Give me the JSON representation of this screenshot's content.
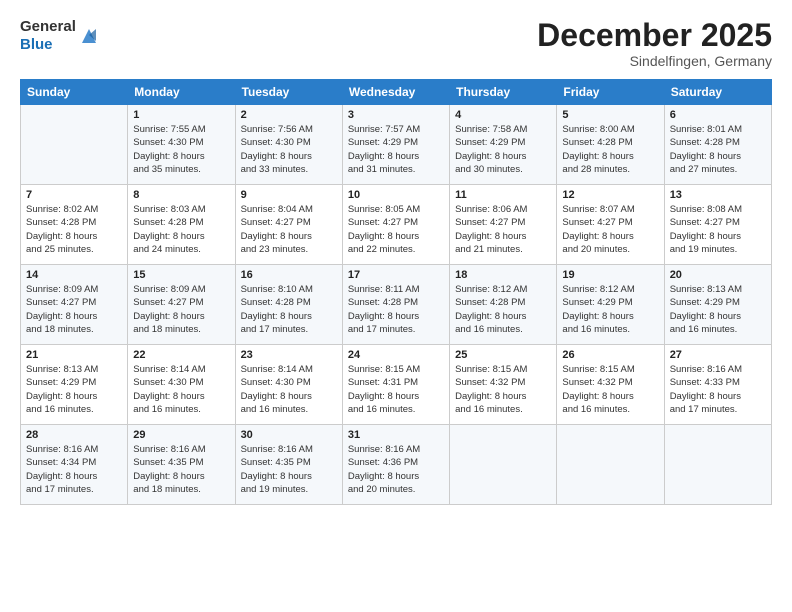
{
  "logo": {
    "line1": "General",
    "line2": "Blue"
  },
  "header": {
    "month": "December 2025",
    "location": "Sindelfingen, Germany"
  },
  "weekdays": [
    "Sunday",
    "Monday",
    "Tuesday",
    "Wednesday",
    "Thursday",
    "Friday",
    "Saturday"
  ],
  "weeks": [
    [
      {
        "day": "",
        "info": ""
      },
      {
        "day": "1",
        "info": "Sunrise: 7:55 AM\nSunset: 4:30 PM\nDaylight: 8 hours\nand 35 minutes."
      },
      {
        "day": "2",
        "info": "Sunrise: 7:56 AM\nSunset: 4:30 PM\nDaylight: 8 hours\nand 33 minutes."
      },
      {
        "day": "3",
        "info": "Sunrise: 7:57 AM\nSunset: 4:29 PM\nDaylight: 8 hours\nand 31 minutes."
      },
      {
        "day": "4",
        "info": "Sunrise: 7:58 AM\nSunset: 4:29 PM\nDaylight: 8 hours\nand 30 minutes."
      },
      {
        "day": "5",
        "info": "Sunrise: 8:00 AM\nSunset: 4:28 PM\nDaylight: 8 hours\nand 28 minutes."
      },
      {
        "day": "6",
        "info": "Sunrise: 8:01 AM\nSunset: 4:28 PM\nDaylight: 8 hours\nand 27 minutes."
      }
    ],
    [
      {
        "day": "7",
        "info": "Sunrise: 8:02 AM\nSunset: 4:28 PM\nDaylight: 8 hours\nand 25 minutes."
      },
      {
        "day": "8",
        "info": "Sunrise: 8:03 AM\nSunset: 4:28 PM\nDaylight: 8 hours\nand 24 minutes."
      },
      {
        "day": "9",
        "info": "Sunrise: 8:04 AM\nSunset: 4:27 PM\nDaylight: 8 hours\nand 23 minutes."
      },
      {
        "day": "10",
        "info": "Sunrise: 8:05 AM\nSunset: 4:27 PM\nDaylight: 8 hours\nand 22 minutes."
      },
      {
        "day": "11",
        "info": "Sunrise: 8:06 AM\nSunset: 4:27 PM\nDaylight: 8 hours\nand 21 minutes."
      },
      {
        "day": "12",
        "info": "Sunrise: 8:07 AM\nSunset: 4:27 PM\nDaylight: 8 hours\nand 20 minutes."
      },
      {
        "day": "13",
        "info": "Sunrise: 8:08 AM\nSunset: 4:27 PM\nDaylight: 8 hours\nand 19 minutes."
      }
    ],
    [
      {
        "day": "14",
        "info": "Sunrise: 8:09 AM\nSunset: 4:27 PM\nDaylight: 8 hours\nand 18 minutes."
      },
      {
        "day": "15",
        "info": "Sunrise: 8:09 AM\nSunset: 4:27 PM\nDaylight: 8 hours\nand 18 minutes."
      },
      {
        "day": "16",
        "info": "Sunrise: 8:10 AM\nSunset: 4:28 PM\nDaylight: 8 hours\nand 17 minutes."
      },
      {
        "day": "17",
        "info": "Sunrise: 8:11 AM\nSunset: 4:28 PM\nDaylight: 8 hours\nand 17 minutes."
      },
      {
        "day": "18",
        "info": "Sunrise: 8:12 AM\nSunset: 4:28 PM\nDaylight: 8 hours\nand 16 minutes."
      },
      {
        "day": "19",
        "info": "Sunrise: 8:12 AM\nSunset: 4:29 PM\nDaylight: 8 hours\nand 16 minutes."
      },
      {
        "day": "20",
        "info": "Sunrise: 8:13 AM\nSunset: 4:29 PM\nDaylight: 8 hours\nand 16 minutes."
      }
    ],
    [
      {
        "day": "21",
        "info": "Sunrise: 8:13 AM\nSunset: 4:29 PM\nDaylight: 8 hours\nand 16 minutes."
      },
      {
        "day": "22",
        "info": "Sunrise: 8:14 AM\nSunset: 4:30 PM\nDaylight: 8 hours\nand 16 minutes."
      },
      {
        "day": "23",
        "info": "Sunrise: 8:14 AM\nSunset: 4:30 PM\nDaylight: 8 hours\nand 16 minutes."
      },
      {
        "day": "24",
        "info": "Sunrise: 8:15 AM\nSunset: 4:31 PM\nDaylight: 8 hours\nand 16 minutes."
      },
      {
        "day": "25",
        "info": "Sunrise: 8:15 AM\nSunset: 4:32 PM\nDaylight: 8 hours\nand 16 minutes."
      },
      {
        "day": "26",
        "info": "Sunrise: 8:15 AM\nSunset: 4:32 PM\nDaylight: 8 hours\nand 16 minutes."
      },
      {
        "day": "27",
        "info": "Sunrise: 8:16 AM\nSunset: 4:33 PM\nDaylight: 8 hours\nand 17 minutes."
      }
    ],
    [
      {
        "day": "28",
        "info": "Sunrise: 8:16 AM\nSunset: 4:34 PM\nDaylight: 8 hours\nand 17 minutes."
      },
      {
        "day": "29",
        "info": "Sunrise: 8:16 AM\nSunset: 4:35 PM\nDaylight: 8 hours\nand 18 minutes."
      },
      {
        "day": "30",
        "info": "Sunrise: 8:16 AM\nSunset: 4:35 PM\nDaylight: 8 hours\nand 19 minutes."
      },
      {
        "day": "31",
        "info": "Sunrise: 8:16 AM\nSunset: 4:36 PM\nDaylight: 8 hours\nand 20 minutes."
      },
      {
        "day": "",
        "info": ""
      },
      {
        "day": "",
        "info": ""
      },
      {
        "day": "",
        "info": ""
      }
    ]
  ]
}
